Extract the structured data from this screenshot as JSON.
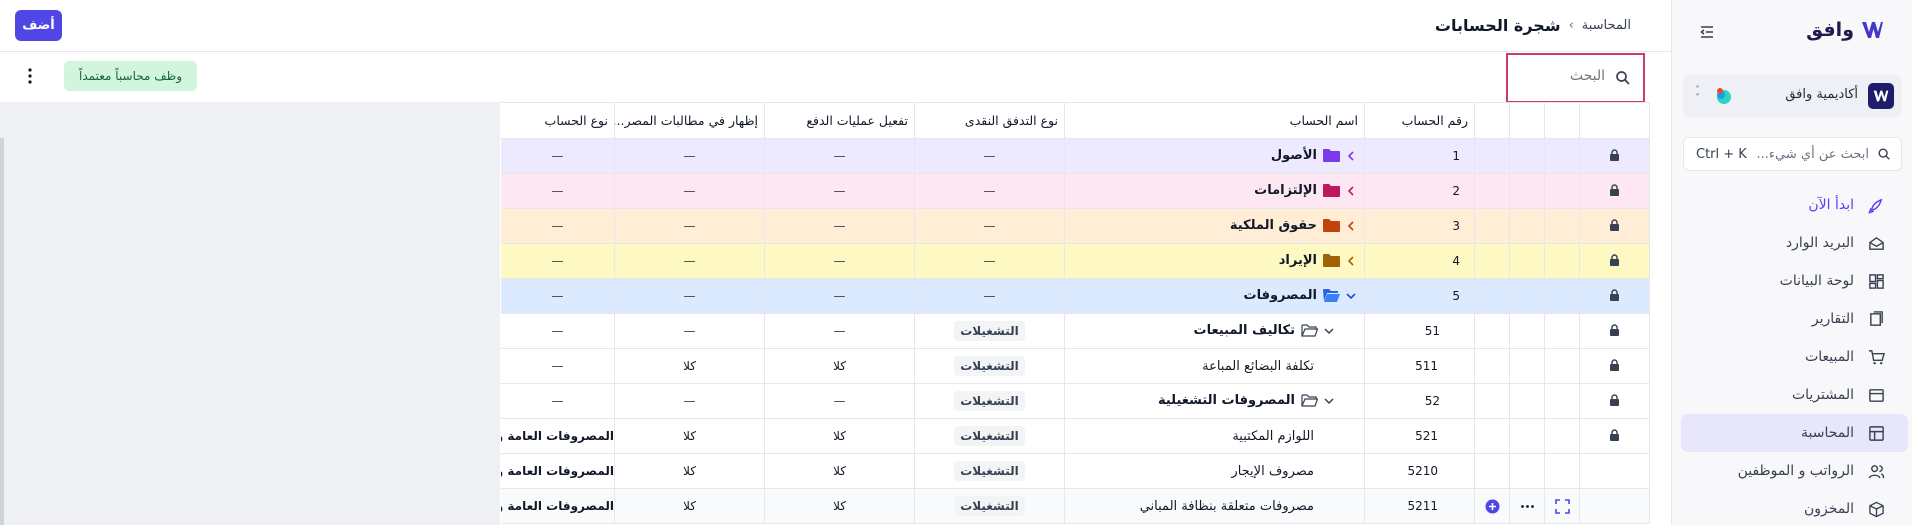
{
  "app": {
    "logo_text": "وافق"
  },
  "sidebar": {
    "org_name": "أكاديمية وافق",
    "search_placeholder": "ابحث عن أي شيء...",
    "search_shortcut": "Ctrl + K",
    "items": [
      {
        "label": "ابدأ الآن",
        "icon": "rocket-icon"
      },
      {
        "label": "البريد الوارد",
        "icon": "inbox-icon"
      },
      {
        "label": "لوحة البيانات",
        "icon": "dashboard-icon"
      },
      {
        "label": "التقارير",
        "icon": "reports-icon"
      },
      {
        "label": "المبيعات",
        "icon": "cart-icon"
      },
      {
        "label": "المشتريات",
        "icon": "purchases-icon"
      },
      {
        "label": "المحاسبة",
        "icon": "accounting-icon"
      },
      {
        "label": "الرواتب و الموظفين",
        "icon": "people-icon"
      },
      {
        "label": "المخزون",
        "icon": "box-icon"
      }
    ]
  },
  "header": {
    "breadcrumb_parent": "المحاسبة",
    "breadcrumb_separator": "›",
    "title": "شجرة الحسابات",
    "add_label": "أضف"
  },
  "toolbar": {
    "search_placeholder": "البحث",
    "hire_label": "وظف محاسباً معتمداً"
  },
  "table": {
    "columns": [
      "رقم الحساب",
      "اسم الحساب",
      "نوع التدفق النقدى",
      "تفعيل عمليات الدفع",
      "إظهار في مطالبات المصر...",
      "نوع الحساب"
    ],
    "rows": [
      {
        "num": "1",
        "name": "الأصول",
        "flow": "—",
        "pay": "—",
        "claims": "—",
        "type": "—"
      },
      {
        "num": "2",
        "name": "الإلتزامات",
        "flow": "—",
        "pay": "—",
        "claims": "—",
        "type": "—"
      },
      {
        "num": "3",
        "name": "حقوق الملكية",
        "flow": "—",
        "pay": "—",
        "claims": "—",
        "type": "—"
      },
      {
        "num": "4",
        "name": "الإيراد",
        "flow": "—",
        "pay": "—",
        "claims": "—",
        "type": "—"
      },
      {
        "num": "5",
        "name": "المصروفات",
        "flow": "—",
        "pay": "—",
        "claims": "—",
        "type": "—"
      },
      {
        "num": "51",
        "name": "تكاليف المبيعات",
        "flow": "التشغيلات",
        "pay": "—",
        "claims": "—",
        "type": "—"
      },
      {
        "num": "511",
        "name": "تكلفة البضائع المباعة",
        "flow": "التشغيلات",
        "pay": "كلا",
        "claims": "كلا",
        "type": "—"
      },
      {
        "num": "52",
        "name": "المصروفات التشغيلية",
        "flow": "التشغيلات",
        "pay": "—",
        "claims": "—",
        "type": "—"
      },
      {
        "num": "521",
        "name": "اللوازم المكتبية",
        "flow": "التشغيلات",
        "pay": "كلا",
        "claims": "كلا",
        "type": "المصروفات العامة والإدارية"
      },
      {
        "num": "5210",
        "name": "مصروف الإيجار",
        "flow": "التشغيلات",
        "pay": "كلا",
        "claims": "كلا",
        "type": "المصروفات العامة والإدارية"
      },
      {
        "num": "5211",
        "name": "مصروفات متعلقة بنظافة المباني",
        "flow": "التشغيلات",
        "pay": "كلا",
        "claims": "كلا",
        "type": "المصروفات العامة والإدارية"
      }
    ]
  },
  "colors": {
    "primary": "#4f46e5",
    "highlight_border": "#cc3a72",
    "row_assets": "#ede9fe",
    "row_liabilities": "#fce7f3",
    "row_equity": "#ffedd5",
    "row_revenue": "#fef9c3",
    "row_expenses": "#dbeafe",
    "chip_green": "#d1f5dd"
  }
}
